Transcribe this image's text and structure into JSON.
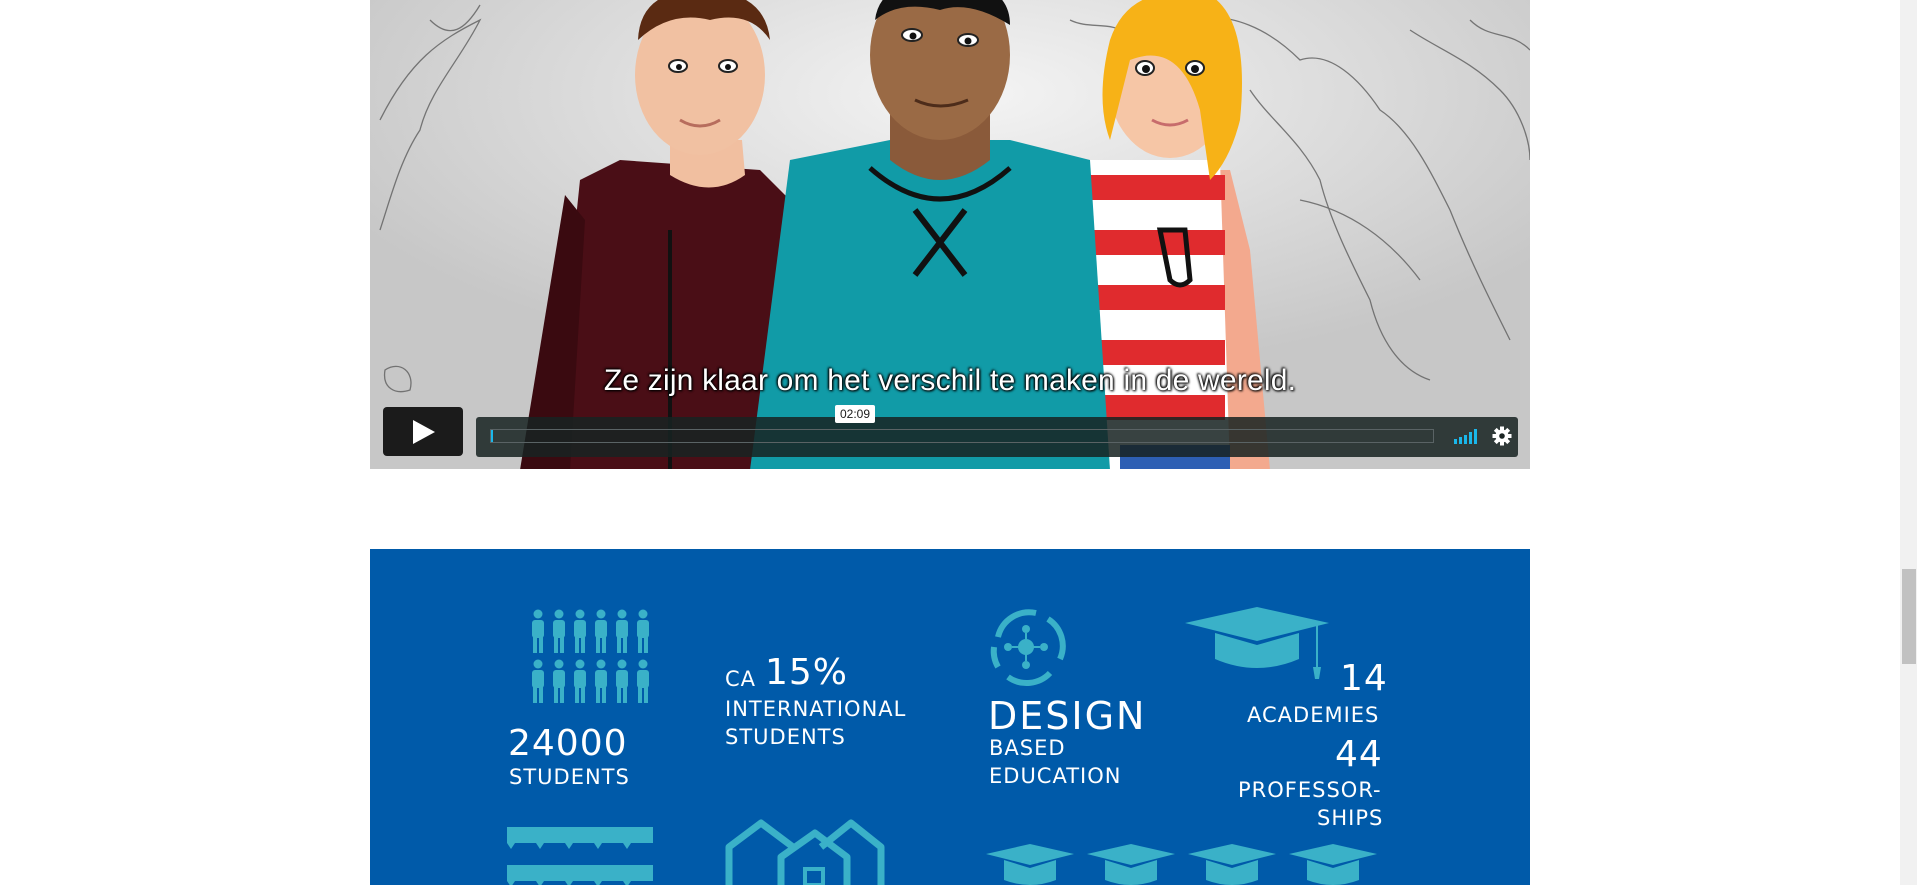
{
  "video": {
    "subtitle": "Ze zijn klaar om het verschil te maken in de wereld.",
    "time_tooltip": "02:09",
    "progress": 0.002,
    "accent_color": "#1ab7ea",
    "icons": {
      "play": "play-icon",
      "volume": "volume-icon",
      "settings": "gear-icon"
    }
  },
  "infographic": {
    "background_color": "#005aa9",
    "icon_color": "#3ab1c8",
    "students": {
      "number": "24000",
      "label": "STUDENTS"
    },
    "international": {
      "prefix": "CA",
      "percent": "15%",
      "line1": "INTERNATIONAL",
      "line2": "STUDENTS"
    },
    "design": {
      "title": "DESIGN",
      "line1": "BASED",
      "line2": "EDUCATION"
    },
    "academies": {
      "number": "14",
      "label": "ACADEMIES"
    },
    "professorships": {
      "number": "44",
      "line1": "PROFESSOR-",
      "line2": "SHIPS"
    }
  }
}
